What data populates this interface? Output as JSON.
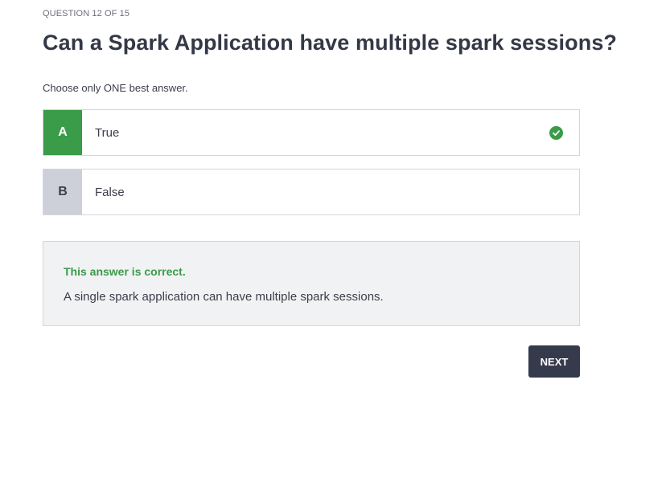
{
  "progress": "QUESTION 12 OF 15",
  "question": "Can a Spark Application have multiple spark sessions?",
  "instruction": "Choose only ONE best answer.",
  "options": [
    {
      "letter": "A",
      "text": "True",
      "selected": true,
      "correct": true
    },
    {
      "letter": "B",
      "text": "False",
      "selected": false,
      "correct": false
    }
  ],
  "feedback": {
    "title": "This answer is correct.",
    "explanation": "A single spark application can have multiple spark sessions."
  },
  "next_label": "NEXT",
  "colors": {
    "correct_green": "#3a9b48",
    "button_dark": "#363a4d",
    "option_letter_gray": "#cdd0d8",
    "feedback_bg": "#f1f2f4"
  },
  "icons": {
    "correct_indicator": "check-circle-icon"
  }
}
